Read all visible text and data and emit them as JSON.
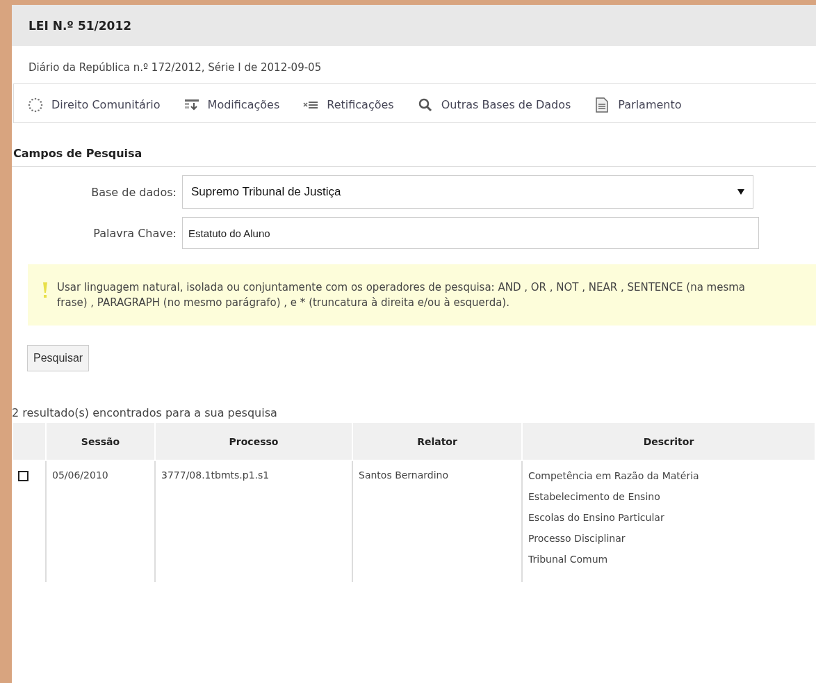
{
  "header": {
    "title": "LEI N.º 51/2012",
    "subtitle": "Diário da República n.º 172/2012, Série I de 2012-09-05"
  },
  "links": [
    {
      "kind": "stars",
      "label": "Direito Comunitário"
    },
    {
      "kind": "table",
      "label": "Modificações"
    },
    {
      "kind": "xlist",
      "label": "Retificações"
    },
    {
      "kind": "search",
      "label": "Outras Bases de Dados"
    },
    {
      "kind": "document",
      "label": "Parlamento"
    }
  ],
  "search_form": {
    "heading": "Campos de Pesquisa",
    "database": {
      "label": "Base de dados:",
      "value": "Supremo Tribunal de Justiça"
    },
    "keyword": {
      "label": "Palavra Chave:",
      "value": "Estatuto do Aluno"
    },
    "hint": "Usar linguagem natural, isolada ou conjuntamente com os operadores de pesquisa: AND , OR , NOT , NEAR , SENTENCE (na mesma frase) , PARAGRAPH (no mesmo parágrafo) , e * (truncatura à direita e/ou à esquerda).",
    "submit": "Pesquisar"
  },
  "results": {
    "summary": "2 resultado(s) encontrados para a sua pesquisa",
    "columns": [
      "Sessão",
      "Processo",
      "Relator",
      "Descritor"
    ],
    "rows": [
      {
        "checked": false,
        "sessao": "05/06/2010",
        "processo": "3777/08.1tbmts.p1.s1",
        "relator": "Santos Bernardino",
        "descritor": [
          "Competência em Razão da Matéria",
          "Estabelecimento de Ensino",
          "Escolas do Ensino Particular",
          "Processo Disciplinar",
          "Tribunal Comum"
        ]
      }
    ]
  }
}
